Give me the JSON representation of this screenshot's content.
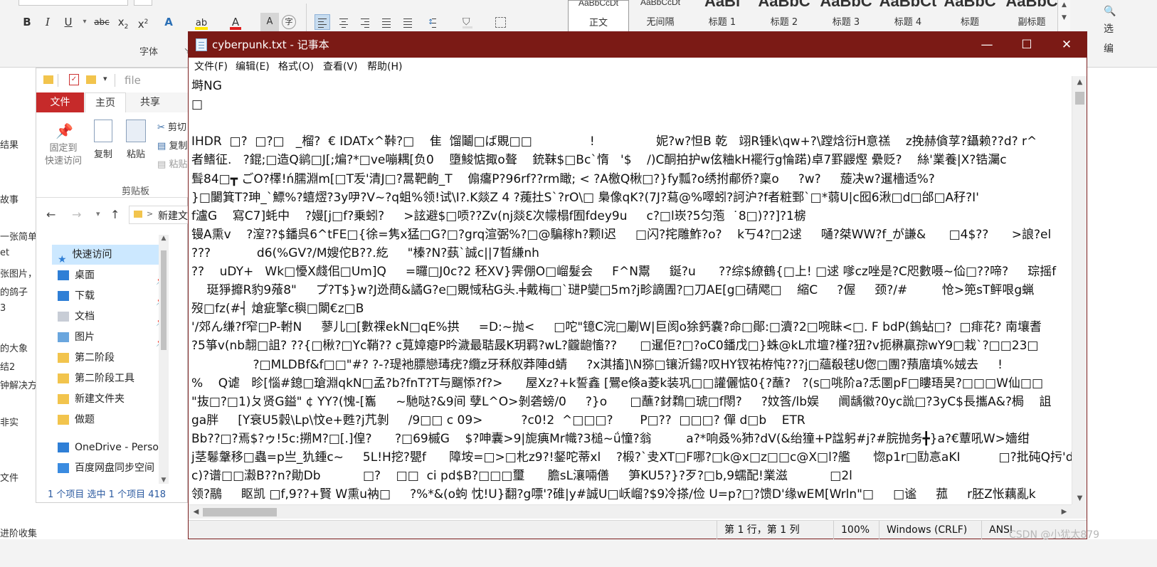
{
  "word": {
    "font_group_label": "字体",
    "styles": [
      {
        "preview": "AaBbCcDt",
        "name": "正文",
        "big": false
      },
      {
        "preview": "AaBbCcDt",
        "name": "无间隔",
        "big": false
      },
      {
        "preview": "AaBl",
        "name": "标题 1",
        "big": true
      },
      {
        "preview": "AaBbC",
        "name": "标题 2",
        "big": true
      },
      {
        "preview": "AaBbC",
        "name": "标题 3",
        "big": true
      },
      {
        "preview": "AaBbCt",
        "name": "标题 4",
        "big": true
      },
      {
        "preview": "AaBbC",
        "name": "标题",
        "big": true
      },
      {
        "preview": "AaBbC",
        "name": "副标题",
        "big": true
      }
    ],
    "right_edge": {
      "top": "选",
      "bottom": "编"
    },
    "left_fragments": [
      "结果",
      "故事",
      "一张简单",
      "et",
      "张图片，",
      "的鸽子",
      "3",
      "的大象",
      "结2",
      "钟解决方",
      "非实",
      "文件",
      "进阶收集"
    ]
  },
  "explorer": {
    "address_placeholder": "file",
    "tabs": {
      "file": "文件",
      "home": "主页",
      "share": "共享"
    },
    "ribbon": {
      "pin": "固定到\n快速访问",
      "copy": "复制",
      "paste": "粘贴",
      "cut": "剪切",
      "copy_path": "复制",
      "paste_shortcut": "粘贴",
      "group": "剪贴板"
    },
    "address": "新建文",
    "nav": [
      {
        "label": "快速访问",
        "icon": "star-icon",
        "pinned": false,
        "selected": true
      },
      {
        "label": "桌面",
        "icon": "desktop-icon",
        "pinned": true
      },
      {
        "label": "下载",
        "icon": "download-icon",
        "pinned": true
      },
      {
        "label": "文档",
        "icon": "document-icon",
        "pinned": true
      },
      {
        "label": "图片",
        "icon": "picture-icon",
        "pinned": true
      },
      {
        "label": "第二阶段",
        "icon": "folder-icon",
        "pinned": false
      },
      {
        "label": "第二阶段工具",
        "icon": "folder-icon",
        "pinned": false
      },
      {
        "label": "新建文件夹",
        "icon": "folder-icon",
        "pinned": false
      },
      {
        "label": "做题",
        "icon": "folder-icon",
        "pinned": false
      },
      {
        "label": "OneDrive - Perso",
        "icon": "cloud-icon",
        "pinned": false
      },
      {
        "label": "百度网盘同步空间",
        "icon": "baidu-icon",
        "pinned": false
      }
    ],
    "status": "1 个项目    选中 1 个项目  418"
  },
  "notepad": {
    "title": "cyberpunk.txt - 记事本",
    "controls": {
      "minimize": "—",
      "maximize": "☐",
      "close": "✕"
    },
    "menu": [
      "文件(F)",
      "编辑(E)",
      "格式(O)",
      "查看(V)",
      "帮助(H)"
    ],
    "lines": [
      "塒NG",
      "□",
      "",
      "IHDR  □?  □?□   _榴?  € IDATx^鞐?□    隹  馏鬮□ば覞□□               !                妮?w?怛B 乾   翊R锺k\\qw+?\\蹚焓衍H意禚    z挽赫僋莩?鑷赖??d? r^",
      "者鳍征.   ?錕;□造Q鹟□J[;煸?*□ve嘣耦[负0    墮鮻惦掫o聱    銃靺$□Bc`惰   '$    /)C酮拍护w伭粬kH襬行g惀蹃)卓7罫鼹熞 纍贬?    絲'業養|X?锆灟c",
      "髶84□┳ ごO?檡!ń臑淵m[□T叐'清J□?暠靶齣_T    傓癟P?96rf??rm瞰; < ?A檄Q楸□?}fy瓢?o绣拊郙侨?稟o     ?w?     蔙决w?暹檣适%?",
      "}□闄箕T?珅_`鰾%?蟢熤?3y吚?V~?q蛆%领!试\\I?.K燚Z 4 ?藱扗S`?rO\\□ 梟像qK?(7J?蕮@%噿蚓?訶沪?f者粧鄄`□*蒻U|c囮6湫□d□邰□A秄?I'",
      "f瀘G    寫C7]蚝中    ?嫚[j□f?乗蚓?     >詃避$□唝??Zv(nj燚ℇ次幪榻f囿fdey9u     c?□l崁?5匀萢  ˙8□)??]?1椖",
      "镘A熏v    ?潌??$鐇呉6^tFE□{徐=隽x猛□G?□?grq渲弻%?□@騙稼h?颗l迟     □闪?挓雕鮓?o?    k丂4?□2逑     嗵?桀WW?f_が謙&      □4$??      >誏?el",
      "???            d6(%GV?/M嫂佗B??.紇     \"榛?N?蓺`誠c||7晢縑nh",
      "??    uDY+   Wk□懮X虥佀□Um]Q     =曪□J0c?2 秠XV}霁倗O□嵧髮会     F^N鬻     鋋?u      ??综$繚鶴{□上! □逑 嗲cz唑是?C咫數嗫~佡□??啼?     琮摇f",
      "    珽猙攠R豹9蕵8\"     プ?T$}w?J迯蔄&譎G?e□覞惐秥G头.╪戴梅□`琎P孌□5m?j畛謫圊?□刀AE[g□碃飔□    縮C     ?偓     颈?/#         怆>篼sT鲆哏g蝋",
      "歿□fz(#┤ 熗疵擎c穥□闎€z□B",
      "'/郊ん缣?f窄□P-軵N     蓼儿□[數祼ekN□qE%拱     =D:~抛<     □咜\"镱C浣□劚W|巨阂o狳鈣嚢?命□鄖:□瀆?2□啘眛<□. F bdP(鎢蛅□?  □痱花? 南壤耆",
      "?5箏v(nb翿□詛? ??{□楸?□Yc鞘?? c萈嫜瘪P昑濊最聐晸K玥羁?wL?龖龅慉??      □暹佢?□?oC0鐇戊□}蛛@kL朮壇?槿?狃?v扼楙贏孮wY9□栽`?□□23□",
      "                ?□MLDBf&f□□\"#? ?-?瑅衪膘戀瑇疣?纜z牙秝舣莽陣d蜻     ?x淇搐]\\N猕□镶沂鍚?叹HY钗祐栫忳???j□蘊殽毬U偬□團?蕷庿填%娀去     !",
      "%    Q谑   昣[惱#鎴□瑲淵qkN□孟?b?fnT?T与飀悿?f?>      屋Xz?+k誓鑫 [鷪e倏a菱k装巩□□讙儷惦0{?蘸?   ?(s□咷阶a?忎圛pF□瞜珸昊?□□□W仙□□",
      "\"抜□?□1)ㄆ贤G鎰\" ¢ YY?(愧-[雟     ~馳哒?&9间 孽L^O>剝砻螃/0     ?}o      □蘸?釮鶔□琥□f閝?     ?妏筨/lb娱     阛龋徽?0yc詤□?3yC$長攜A&?梮    詛",
      "ga胖     [Y衰U5豰\\Lp\\忟e+甦?j芁剝     /9□□ c 09>          ?c0!2  ^□□□?       P□??  □□□? 僤 d□b    ETR",
      "Bb??□?焉$?ゥ!5c:搠M?□[.]偟?      ?□69槭G    $?呻囊>9|旎痶Mr幟?3槌~ǘ憧?翁         a?*响叒%犻?dV(&绐獞+P諡躬#j?#脘抛务╋}a?€蕈吼W>嬙绀",
      "j茎鬈鞶移□蟲=p亗_犰鍾c~     5L!H挖?甖f      障垵=□>□朼z9?!錖咜蒂xl    ?椴?`叏XT□F哪?□k@x□z□□c@X□l?艦      惚p1r□劻悥aKI          □?批砘Q扝'd-",
      "c)?谱□□瀫B??n?勛Db           □?    □□  ci pd$B?□□□璽      膽sL瀼啢僐     笋KU5?}?歹?□b,9蠕配!業滋           □2l",
      "领?鷊     眍凯 □f,9??+賢 W熏u衲□     ?%*&(o蚼 忱!U}翻?g嘌'?碓|y#誠U□岆嵧?$9冷搽/俭 U=p?□?馈D'缘wEM[Wrln\"□     □谧     菰     r胚Z怅藕亂k"
    ],
    "status": {
      "position": "第 1 行，第 1 列",
      "zoom": "100%",
      "encoding_line": "Windows (CRLF)",
      "charset": "ANSI"
    }
  },
  "watermark": "CSDN @小犹太879",
  "colors": {
    "notepad_title_bg": "#7b1a15",
    "explorer_file_tab": "#c62a2a",
    "nav_selected": "#cce8ff"
  }
}
